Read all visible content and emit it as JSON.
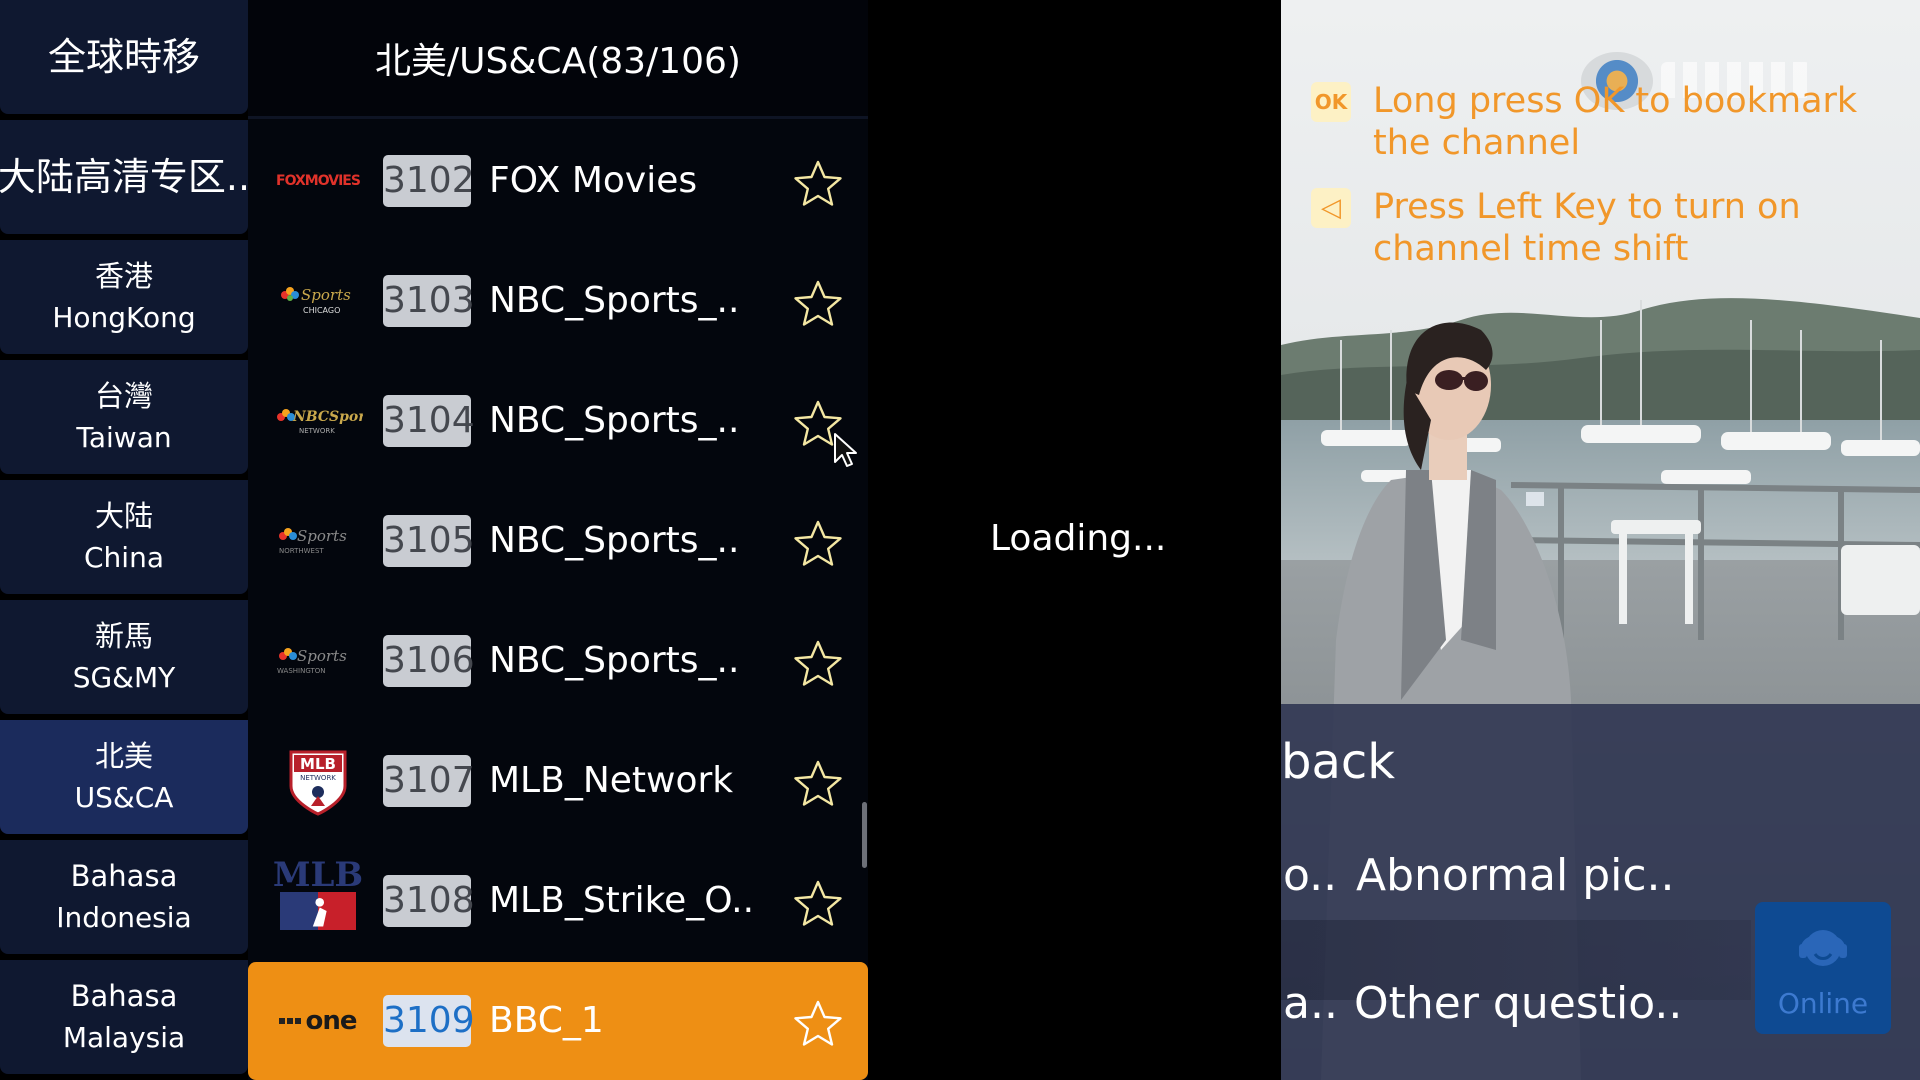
{
  "categories": [
    {
      "line1": "全球時移",
      "line2": ""
    },
    {
      "line1": "大陆高清专区..",
      "line2": ""
    },
    {
      "line1": "香港",
      "line2": "HongKong"
    },
    {
      "line1": "台灣",
      "line2": "Taiwan"
    },
    {
      "line1": "大陆",
      "line2": "China"
    },
    {
      "line1": "新馬",
      "line2": "SG&MY"
    },
    {
      "line1": "北美",
      "line2": "US&CA"
    },
    {
      "line1": "Bahasa",
      "line2": "Indonesia"
    },
    {
      "line1": "Bahasa",
      "line2": "Malaysia"
    }
  ],
  "active_category_index": 6,
  "list_header": "北美/US&CA(83/106)",
  "channels": [
    {
      "number": "3102",
      "name": "FOX Movies",
      "logo": "fox-movies-logo"
    },
    {
      "number": "3103",
      "name": "NBC_Sports_..",
      "logo": "nbc-sports-chicago-logo"
    },
    {
      "number": "3104",
      "name": "NBC_Sports_..",
      "logo": "nbc-sports-network-logo"
    },
    {
      "number": "3105",
      "name": "NBC_Sports_..",
      "logo": "nbc-sports-northwest-logo"
    },
    {
      "number": "3106",
      "name": "NBC_Sports_..",
      "logo": "nbc-sports-washington-logo"
    },
    {
      "number": "3107",
      "name": "MLB_Network",
      "logo": "mlb-network-logo"
    },
    {
      "number": "3108",
      "name": "MLB_Strike_O..",
      "logo": "mlb-logo"
    },
    {
      "number": "3109",
      "name": "BBC_1",
      "logo": "bbc-one-logo"
    }
  ],
  "logo_text": {
    "fox": "FOXMOVIES",
    "nbc_chicago": "CHICAGO",
    "nbc_network": "NETWORK",
    "nbc_northwest": "NORTHWEST",
    "nbc_washington": "WASHINGTON",
    "mlb_network": "MLB",
    "mlb_network_sub": "NETWORK",
    "mlb": "MLB",
    "bbc": "one"
  },
  "active_channel_index": 7,
  "loading_text": "Loading...",
  "tips": [
    {
      "icon": "OK",
      "text": "Long press OK to bookmark the channel"
    },
    {
      "icon": "◁",
      "text": "Press Left Key to turn on channel time shift"
    }
  ],
  "overlay": {
    "title": "back",
    "option1_prefix": "o..",
    "option1": "Abnormal pic..",
    "option2_prefix": "a..",
    "option2": "Other questio..",
    "online_label": "Online"
  },
  "colors": {
    "accent_orange": "#ee8f14",
    "tip_orange": "#f1972a",
    "category_bg": "#0f1830",
    "category_active_bg": "#1b2b5c"
  }
}
